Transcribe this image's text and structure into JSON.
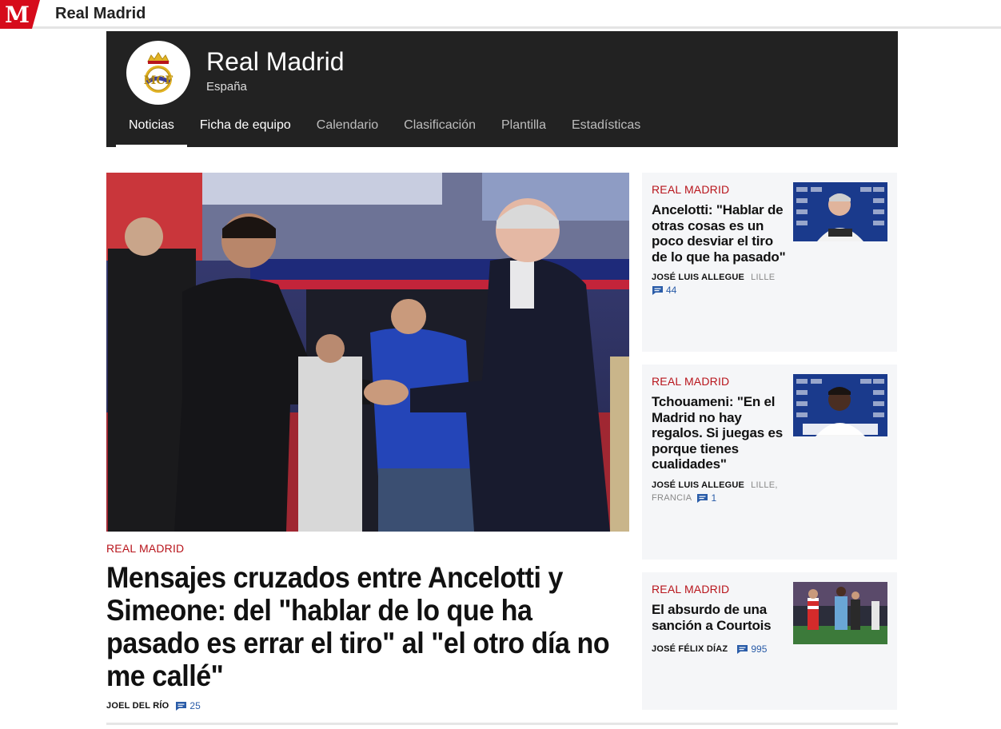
{
  "topbar": {
    "section_title": "Real Madrid"
  },
  "team": {
    "name": "Real Madrid",
    "country": "España",
    "tabs": [
      {
        "label": "Noticias",
        "active": true
      },
      {
        "label": "Ficha de equipo"
      },
      {
        "label": "Calendario"
      },
      {
        "label": "Clasificación"
      },
      {
        "label": "Plantilla"
      },
      {
        "label": "Estadísticas"
      }
    ]
  },
  "main_story": {
    "kicker": "REAL MADRID",
    "title": "Mensajes cruzados entre Ancelotti y Simeone: del \"hablar de lo que ha pasado es errar el tiro\" al \"el otro día no me callé\"",
    "author": "JOEL DEL RÍO",
    "comments": "25"
  },
  "side_stories": [
    {
      "kicker": "REAL MADRID",
      "title": "Ancelotti: \"Hablar de otras cosas es un poco desviar el tiro de lo que ha pasado\"",
      "author": "JOSÉ LUIS ALLEGUE",
      "location": "LILLE",
      "comments": "44"
    },
    {
      "kicker": "REAL MADRID",
      "title": "Tchouameni: \"En el Madrid no hay regalos. Si juegas es porque tienes cualidades\"",
      "author": "JOSÉ LUIS ALLEGUE",
      "location": "LILLE, FRANCIA",
      "comments": "1"
    },
    {
      "kicker": "REAL MADRID",
      "title": "El absurdo de una sanción a Courtois",
      "author": "JOSÉ FÉLIX DÍAZ",
      "location": "",
      "comments": "995"
    }
  ],
  "colors": {
    "brand_red": "#d60b1b",
    "kicker_red": "#b8141b",
    "header_dark": "#222222",
    "comment_blue": "#2a5ca8"
  }
}
